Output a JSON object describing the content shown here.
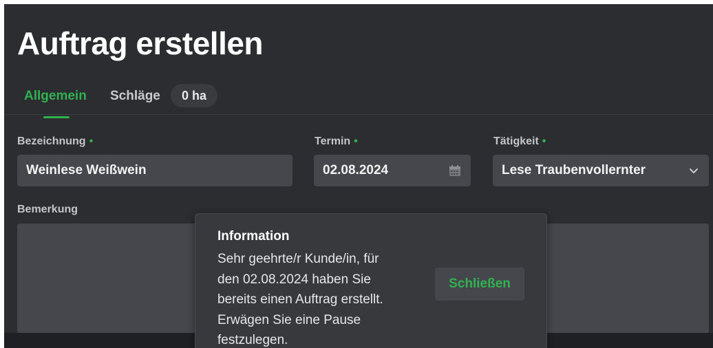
{
  "page": {
    "title": "Auftrag erstellen"
  },
  "tabs": {
    "general": "Allgemein",
    "plots": "Schläge",
    "plots_area": "0 ha"
  },
  "form": {
    "name_label": "Bezeichnung",
    "name_value": "Weinlese Weißwein",
    "date_label": "Termin",
    "date_value": "02.08.2024",
    "activity_label": "Tätigkeit",
    "activity_value": "Lese Traubenvollernter",
    "remark_label": "Bemerkung",
    "required_marker": "•"
  },
  "dialog": {
    "title": "Information",
    "lines": [
      "Sehr geehrte/r Kunde/in, für",
      "den 02.08.2024 haben Sie",
      "bereits einen Auftrag erstellt.",
      "Erwägen Sie eine Pause",
      "festzulegen."
    ],
    "close_label": "Schließen"
  },
  "colors": {
    "accent": "#2fb24f",
    "background": "#2c2d30",
    "field": "#45474c",
    "dialog": "#38393d"
  },
  "icons": {
    "date": "calendar-icon",
    "activity": "chevron-down-icon"
  }
}
